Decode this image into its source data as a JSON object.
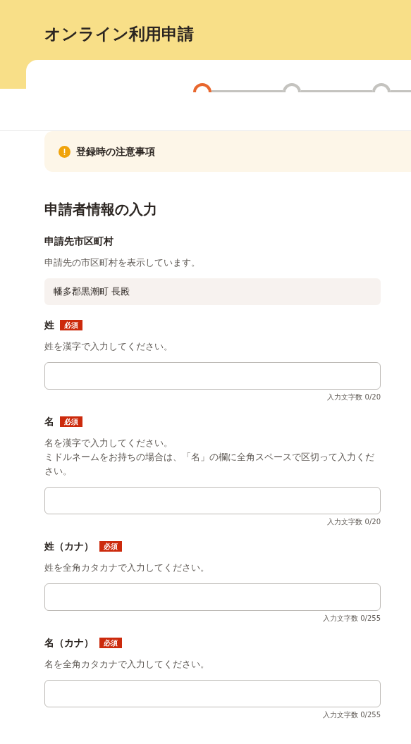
{
  "header": {
    "title": "オンライン利用申請"
  },
  "steps": [
    {
      "selected": true
    },
    {
      "selected": false
    },
    {
      "selected": false
    }
  ],
  "notice": {
    "text": "登録時の注意事項"
  },
  "section": {
    "title": "申請者情報の入力"
  },
  "fields": [
    {
      "kind": "display",
      "label": "申請先市区町村",
      "hint": [
        "申請先の市区町村を表示しています。"
      ],
      "value": "幡多郡黒潮町 長殿"
    },
    {
      "kind": "input",
      "label": "姓",
      "badge": "必須",
      "hint": [
        "姓を漢字で入力してください。"
      ],
      "counter": "入力文字数 0/20"
    },
    {
      "kind": "input",
      "label": "名",
      "badge": "必須",
      "hint": [
        "名を漢字で入力してください。",
        "ミドルネームをお持ちの場合は、「名」の欄に全角スペースで区切って入力ください。"
      ],
      "counter": "入力文字数 0/20"
    },
    {
      "kind": "input",
      "label": "姓（カナ）",
      "badge": "必須",
      "hint": [
        "姓を全角カタカナで入力してください。"
      ],
      "counter": "入力文字数 0/255"
    },
    {
      "kind": "input",
      "label": "名（カナ）",
      "badge": "必須",
      "hint": [
        "名を全角カタカナで入力してください。"
      ],
      "counter": "入力文字数 0/255"
    }
  ]
}
